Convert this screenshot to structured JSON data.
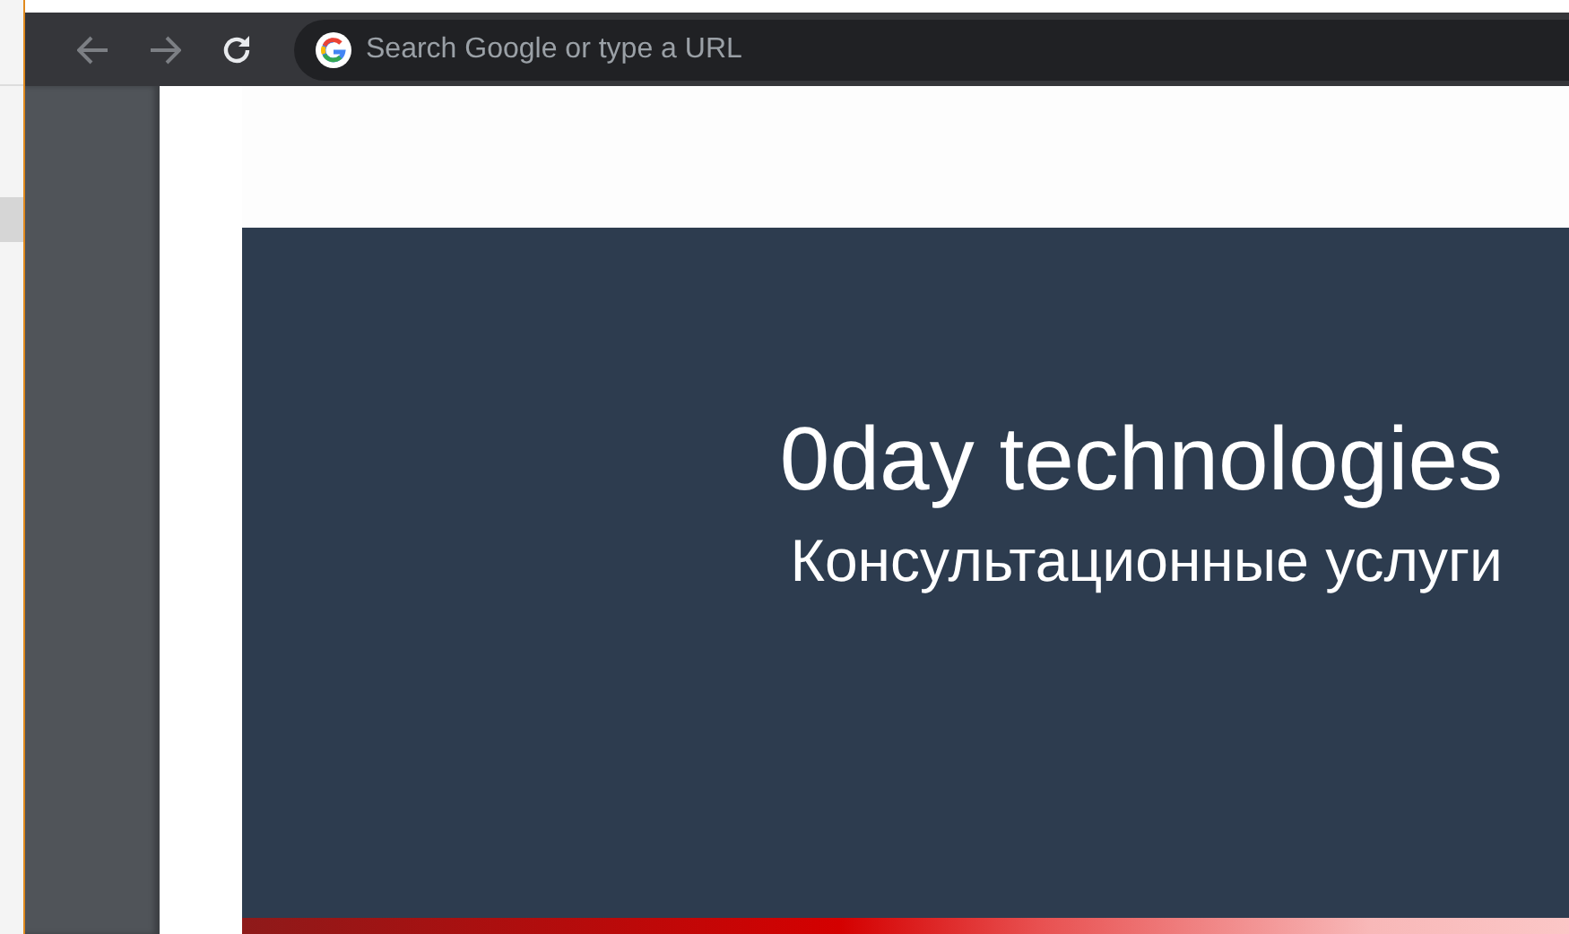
{
  "toolbar": {
    "omnibox": {
      "placeholder": "Search Google or type a URL"
    }
  },
  "hero": {
    "title": "0day technologies",
    "subtitle": "Консультационные услуги"
  }
}
